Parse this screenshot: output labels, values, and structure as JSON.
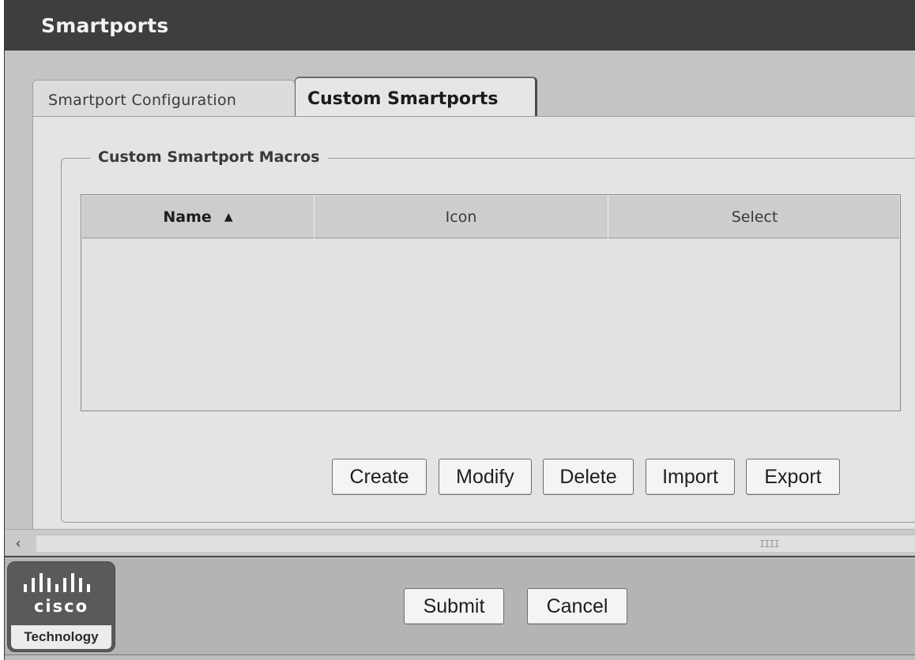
{
  "window": {
    "title": "Smartports"
  },
  "tabs": [
    {
      "label": "Smartport Configuration",
      "active": false
    },
    {
      "label": "Custom Smartports",
      "active": true
    }
  ],
  "macros_group": {
    "legend": "Custom Smartport Macros",
    "table": {
      "columns": [
        {
          "label": "Name",
          "sorted": "ascending"
        },
        {
          "label": "Icon"
        },
        {
          "label": "Select"
        }
      ],
      "sort_indicator": "▲",
      "rows": []
    },
    "buttons": {
      "create": "Create",
      "modify": "Modify",
      "delete": "Delete",
      "import": "Import",
      "export": "Export"
    }
  },
  "scrollbar": {
    "left_arrow": "‹",
    "grip": "IIII"
  },
  "footer": {
    "logo": {
      "brand": "cisco",
      "caption": "Technology"
    },
    "buttons": {
      "submit": "Submit",
      "cancel": "Cancel"
    }
  },
  "colors": {
    "title_bar": "#3e3e3e",
    "panel": "#e4e4e4",
    "background": "#c4c4c4"
  }
}
